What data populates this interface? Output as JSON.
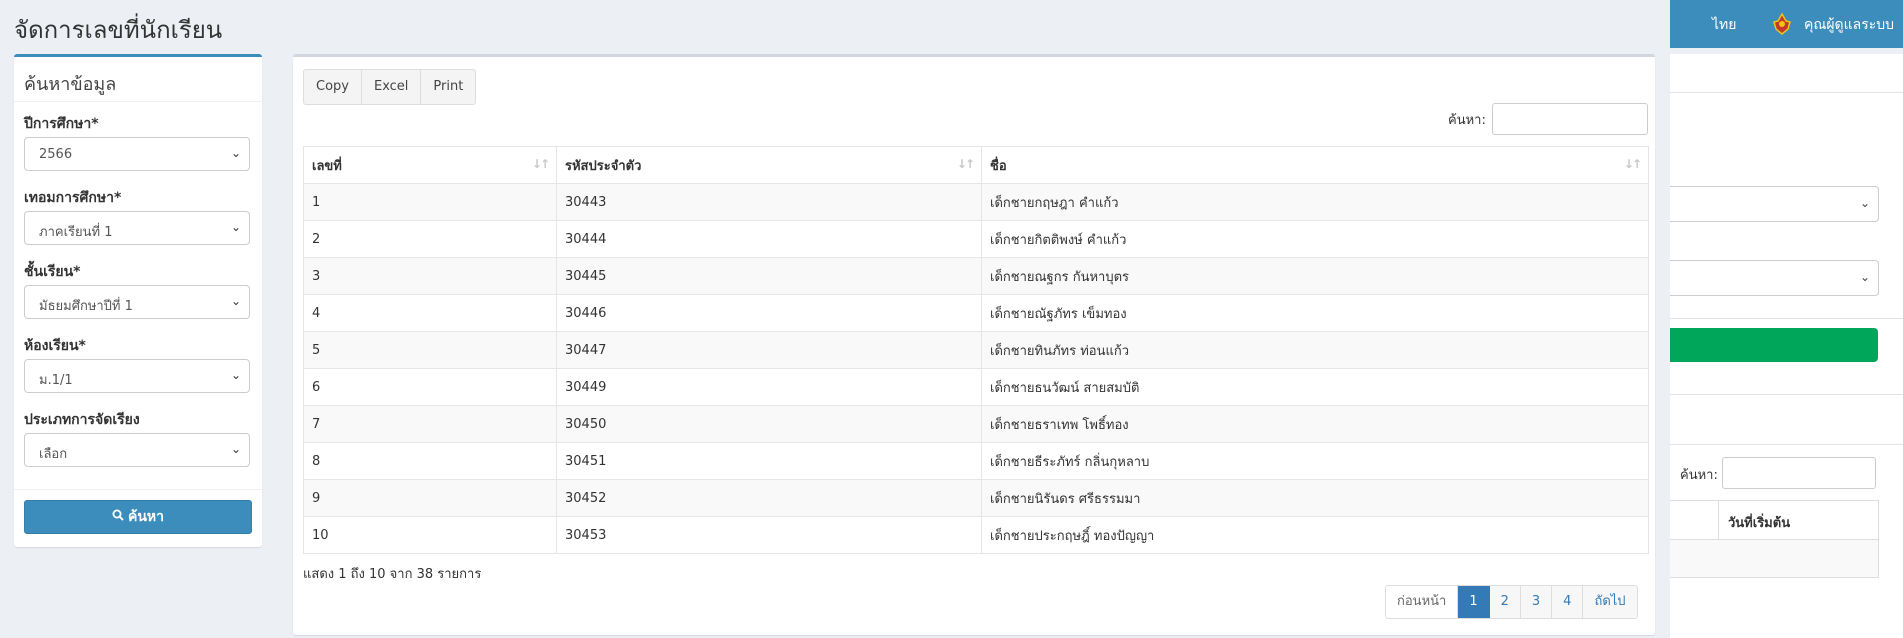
{
  "page": {
    "title": "จัดการเลขที่นักเรียน"
  },
  "topbar": {
    "language": "ไทย",
    "user_name": "คุณผู้ดูแลระบบ"
  },
  "search_panel": {
    "title": "ค้นหาข้อมูล",
    "fields": [
      {
        "label": "ปีการศึกษา*",
        "value": "2566"
      },
      {
        "label": "เทอมการศึกษา*",
        "value": "ภาคเรียนที่ 1"
      },
      {
        "label": "ชั้นเรียน*",
        "value": "มัธยมศึกษาปีที่ 1"
      },
      {
        "label": "ห้องเรียน*",
        "value": "ม.1/1"
      },
      {
        "label": "ประเภทการจัดเรียง",
        "value": "เลือก"
      }
    ],
    "search_button": "ค้นหา"
  },
  "toolbar": {
    "copy": "Copy",
    "excel": "Excel",
    "print": "Print"
  },
  "table_filter": {
    "label": "ค้นหา:",
    "value": ""
  },
  "table": {
    "columns": [
      "เลขที่",
      "รหัสประจำตัว",
      "ชื่อ"
    ],
    "rows": [
      [
        "1",
        "30443",
        "เด็กชายกฤษฎา คำแก้ว"
      ],
      [
        "2",
        "30444",
        "เด็กชายกิตติพงษ์ คำแก้ว"
      ],
      [
        "3",
        "30445",
        "เด็กชายณฐกร กันหาบุตร"
      ],
      [
        "4",
        "30446",
        "เด็กชายณัฐภัทร เข็มทอง"
      ],
      [
        "5",
        "30447",
        "เด็กชายทินภัทร ท่อนแก้ว"
      ],
      [
        "6",
        "30449",
        "เด็กชายธนวัฒน์ สายสมบัติ"
      ],
      [
        "7",
        "30450",
        "เด็กชายธราเทพ โพธิ์ทอง"
      ],
      [
        "8",
        "30451",
        "เด็กชายธีระภัทร์ กลิ่นกุหลาบ"
      ],
      [
        "9",
        "30452",
        "เด็กชายนิรันดร ศรีธรรมมา"
      ],
      [
        "10",
        "30453",
        "เด็กชายประกฤษฎิ์ ทองปัญญา"
      ]
    ]
  },
  "table_info": "แสดง 1 ถึง 10 จาก 38 รายการ",
  "pagination": {
    "prev": "ก่อนหน้า",
    "pages": [
      "1",
      "2",
      "3",
      "4"
    ],
    "active_page": "1",
    "next": "ถัดไป"
  },
  "right_panel": {
    "search_label": "ค้นหา:",
    "column_header": "วันที่เริ่มต้น"
  },
  "colors": {
    "primary": "#3c8dbc",
    "success": "#00a65a",
    "background": "#ecf0f5",
    "page_active": "#337ab7"
  }
}
